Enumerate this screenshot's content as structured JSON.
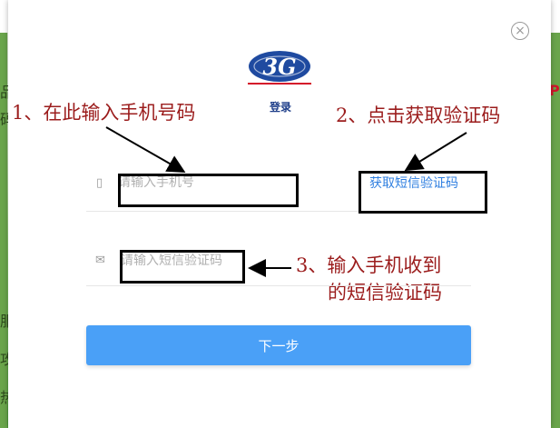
{
  "background": {
    "left_glyphs": [
      "品",
      "码",
      "服",
      "攻",
      "热"
    ],
    "right_glyphs": [
      "P"
    ]
  },
  "dialog": {
    "close_glyph": "×",
    "logo_text": "3G",
    "title": "登录",
    "phone_placeholder": "请输入手机号",
    "code_placeholder": "请输入短信验证码",
    "get_code_label": "获取短信验证码",
    "next_label": "下一步",
    "phone_icon": "mobile-phone-icon",
    "mail_icon": "envelope-icon"
  },
  "annotations": {
    "step1": "1、在此输入手机号码",
    "step2": "2、点击获取验证码",
    "step3_line1": "3、输入手机收到",
    "step3_line2": "的短信验证码"
  },
  "colors": {
    "annotation": "#9b1c1c",
    "accent_button": "#4aa0f7",
    "link": "#2f7fe0",
    "logo_blue": "#1f4aa0",
    "logo_red": "#d4142a"
  }
}
